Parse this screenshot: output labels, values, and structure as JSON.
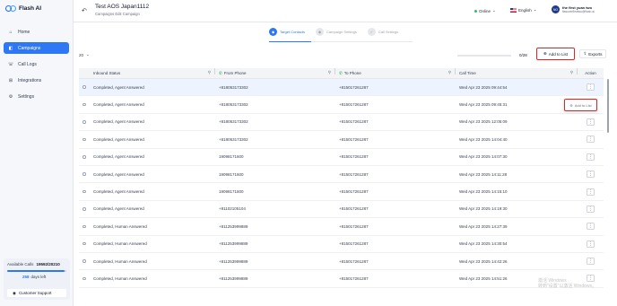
{
  "brand": {
    "name": "Flash AI"
  },
  "sidebar": {
    "items": [
      {
        "label": "Home",
        "icon": "home-icon",
        "active": false
      },
      {
        "label": "Campaigns",
        "icon": "megaphone-icon",
        "active": true
      },
      {
        "label": "Call Logs",
        "icon": "phone-log-icon",
        "active": false
      },
      {
        "label": "Integrations",
        "icon": "puzzle-icon",
        "active": false
      },
      {
        "label": "Settings",
        "icon": "gear-icon",
        "active": false
      }
    ],
    "available_calls_label": "Available Calls",
    "available_calls_value": "19592/20210",
    "available_calls_fraction": 0.969,
    "days_left_value": "258",
    "days_left_label": "days left",
    "support_label": "Customer Support"
  },
  "header": {
    "title": "Test AOS Japan1112",
    "subtitle": "Campaigns Edit Campaign",
    "status": "Online",
    "language": "English",
    "user_initials": "NO",
    "user_name": "the first yuan two",
    "user_email": "flasoverfirsttwo@flash.ai"
  },
  "steps": [
    {
      "label": "Target Contacts",
      "active": true
    },
    {
      "label": "Campaign Settings",
      "active": false
    },
    {
      "label": "Call Settings",
      "active": false
    }
  ],
  "toolbar": {
    "page_size": "20",
    "selected_count": "0/28",
    "add_to_list_label": "Add to List",
    "exports_label": "Exports"
  },
  "table": {
    "headers": {
      "status": "Inbound Status",
      "from": "From Phone",
      "to": "To Phone",
      "time": "Call Time",
      "action": "Action"
    },
    "rows": [
      {
        "status": "Completed, Agent Answered",
        "from": "+818053173302",
        "to": "+815017261287",
        "time": "Wed Apr 23 2025 09:44:54"
      },
      {
        "status": "Completed, Agent Answered",
        "from": "+818053173302",
        "to": "+815017261287",
        "time": "Wed Apr 23 2025 09:45:31"
      },
      {
        "status": "Completed, Agent Answered",
        "from": "+818053173302",
        "to": "+815017261287",
        "time": "Wed Apr 23 2025 12:05:09"
      },
      {
        "status": "Completed, Agent Answered",
        "from": "+818053173302",
        "to": "+815017261287",
        "time": "Wed Apr 23 2025 14:04:40"
      },
      {
        "status": "Completed, Agent Answered",
        "from": "19098171600",
        "to": "+815017261287",
        "time": "Wed Apr 23 2025 14:07:30"
      },
      {
        "status": "Completed, Agent Answered",
        "from": "19098171600",
        "to": "+815017261287",
        "time": "Wed Apr 23 2025 14:11:28"
      },
      {
        "status": "Completed, Agent Answered",
        "from": "19098171600",
        "to": "+815017261287",
        "time": "Wed Apr 23 2025 14:15:10"
      },
      {
        "status": "Completed, Agent Answered",
        "from": "+81102105104",
        "to": "+815017261287",
        "time": "Wed Apr 23 2025 14:19:30"
      },
      {
        "status": "Completed, Human Answered",
        "from": "+811253999889",
        "to": "+815017261287",
        "time": "Wed Apr 23 2025 14:27:39"
      },
      {
        "status": "Completed, Human Answered",
        "from": "+811253999889",
        "to": "+815017261287",
        "time": "Wed Apr 23 2025 14:30:54"
      },
      {
        "status": "Completed, Human Answered",
        "from": "+811253999889",
        "to": "+815017261287",
        "time": "Wed Apr 23 2025 14:42:26"
      },
      {
        "status": "Completed, Human Answered",
        "from": "+811253999889",
        "to": "+815017261287",
        "time": "Wed Apr 23 2025 14:51:26"
      }
    ]
  },
  "popup": {
    "label": "Add to List"
  },
  "watermark": {
    "line1": "激活 Windows",
    "line2": "转到“设置”以激活 Windows。"
  }
}
